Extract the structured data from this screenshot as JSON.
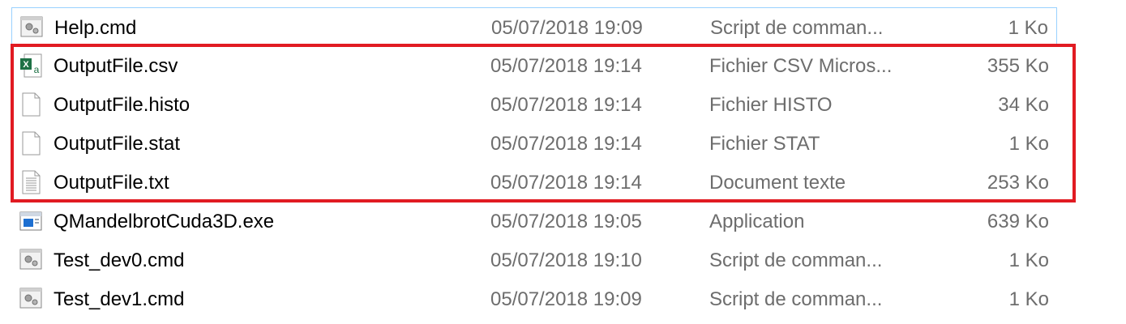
{
  "files": [
    {
      "name": "Help.cmd",
      "date": "05/07/2018 19:09",
      "type": "Script de comman...",
      "size": "1 Ko",
      "icon": "cmd-script-icon"
    },
    {
      "name": "OutputFile.csv",
      "date": "05/07/2018 19:14",
      "type": "Fichier CSV Micros...",
      "size": "355 Ko",
      "icon": "excel-csv-icon"
    },
    {
      "name": "OutputFile.histo",
      "date": "05/07/2018 19:14",
      "type": "Fichier HISTO",
      "size": "34 Ko",
      "icon": "blank-file-icon"
    },
    {
      "name": "OutputFile.stat",
      "date": "05/07/2018 19:14",
      "type": "Fichier STAT",
      "size": "1 Ko",
      "icon": "blank-file-icon"
    },
    {
      "name": "OutputFile.txt",
      "date": "05/07/2018 19:14",
      "type": "Document texte",
      "size": "253 Ko",
      "icon": "text-document-icon"
    },
    {
      "name": "QMandelbrotCuda3D.exe",
      "date": "05/07/2018 19:05",
      "type": "Application",
      "size": "639 Ko",
      "icon": "application-exe-icon"
    },
    {
      "name": "Test_dev0.cmd",
      "date": "05/07/2018 19:10",
      "type": "Script de comman...",
      "size": "1 Ko",
      "icon": "cmd-script-icon"
    },
    {
      "name": "Test_dev1.cmd",
      "date": "05/07/2018 19:09",
      "type": "Script de comman...",
      "size": "1 Ko",
      "icon": "cmd-script-icon"
    }
  ],
  "colors": {
    "highlight_border": "#e11b22",
    "selection_border": "#99d1ff",
    "secondary_text": "#6d6d6d"
  }
}
